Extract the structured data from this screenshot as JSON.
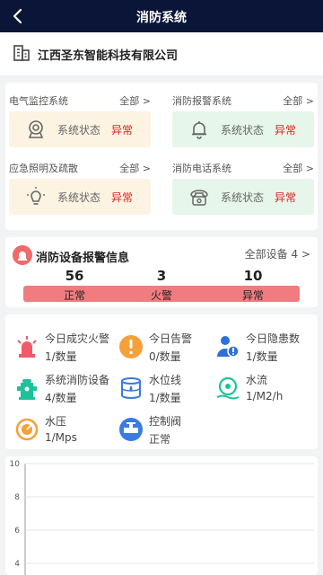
{
  "header": {
    "title": "消防系统"
  },
  "company": {
    "name": "江西圣东智能科技有限公司"
  },
  "systems": [
    {
      "name": "电气监控系统",
      "all": "全部 >",
      "status_label": "系统状态",
      "status": "异常",
      "theme": "orange",
      "icon": "camera-icon"
    },
    {
      "name": "消防报警系统",
      "all": "全部 >",
      "status_label": "系统状态",
      "status": "异常",
      "theme": "green",
      "icon": "bell-icon"
    },
    {
      "name": "应急照明及疏散",
      "all": "全部 >",
      "status_label": "系统状态",
      "status": "异常",
      "theme": "orange",
      "icon": "lightbulb-icon"
    },
    {
      "name": "消防电话系统",
      "all": "全部 >",
      "status_label": "系统状态",
      "status": "异常",
      "theme": "green",
      "icon": "telephone-icon"
    }
  ],
  "alarm": {
    "title": "消防设备报警信息",
    "all_devices": "全部设备 4 >",
    "normal_count": "56",
    "fire_count": "3",
    "abnormal_count": "10",
    "normal_label": "正常",
    "fire_label": "火警",
    "abnormal_label": "异常",
    "bar_color": "#f07c80"
  },
  "stats": [
    {
      "title": "今日成灾火警",
      "value": "1/数量",
      "icon": "siren-icon"
    },
    {
      "title": "今日告警",
      "value": "0/数量",
      "icon": "warning-icon"
    },
    {
      "title": "今日隐患数",
      "value": "1/数量",
      "icon": "hazard-user-icon"
    },
    {
      "title": "系统消防设备",
      "value": "4/数量",
      "icon": "hydrant-icon"
    },
    {
      "title": "水位线",
      "value": "1/数量",
      "icon": "water-tank-icon"
    },
    {
      "title": "水流",
      "value": "1/M2/h",
      "icon": "water-flow-icon"
    },
    {
      "title": "水压",
      "value": "1/Mps",
      "icon": "gauge-icon"
    },
    {
      "title": "控制阀",
      "value": "正常",
      "icon": "valve-icon"
    }
  ],
  "chart_data": {
    "type": "line",
    "ylim": [
      0,
      10
    ],
    "yticks": [
      "10",
      "8",
      "6",
      "4"
    ],
    "grid": true
  }
}
